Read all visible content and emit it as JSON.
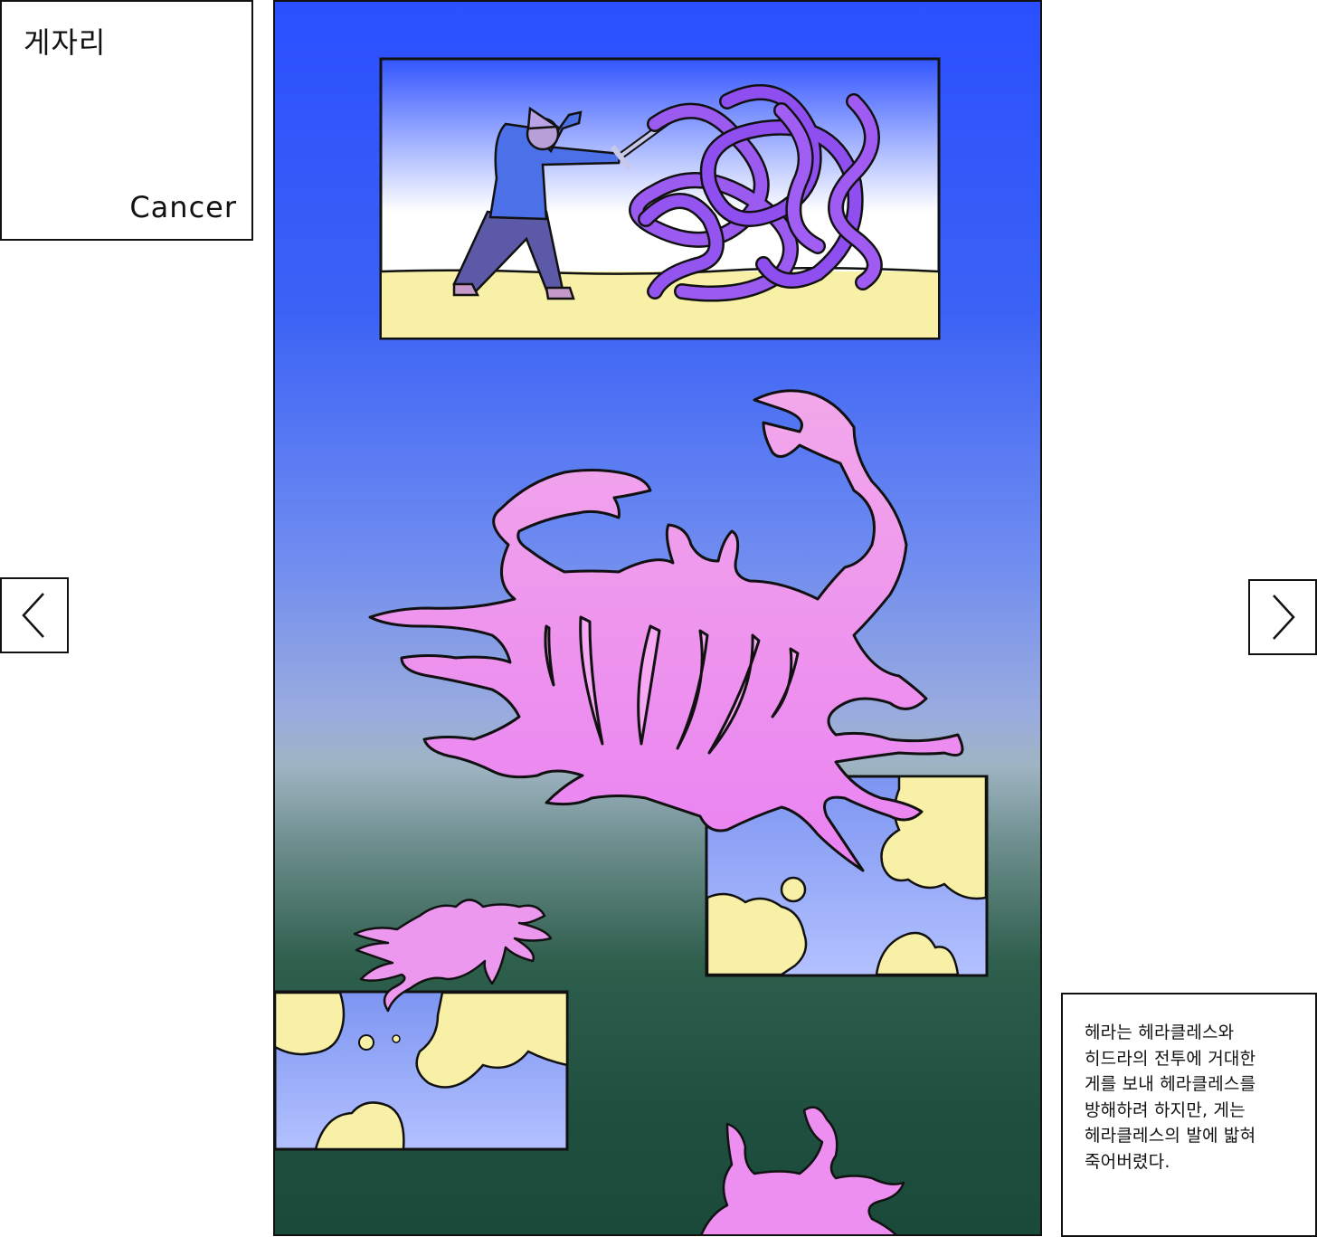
{
  "title": {
    "ko": "게자리",
    "en": "Cancer"
  },
  "navigation": {
    "prev_icon": "chevron-left-icon",
    "next_icon": "chevron-right-icon"
  },
  "caption": {
    "text": "헤라는 헤라클레스와\n히드라의 전투에 거대한\n게를 보내 헤라클레스를\n방해하려 하지만, 게는\n헤라클레스의 발에 밟혀\n죽어버렸다."
  },
  "colors": {
    "sky_top": "#2a4fff",
    "sea_bottom": "#1a4a3a",
    "crab": "#ee8ef0",
    "hydra": "#9a55f0",
    "sand": "#f7f0a6",
    "outline": "#111111"
  }
}
